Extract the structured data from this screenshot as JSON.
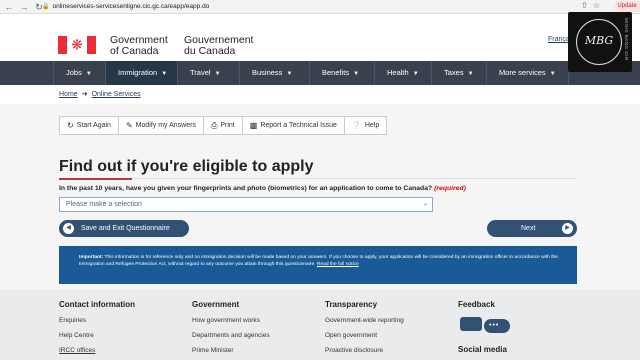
{
  "browser": {
    "url": "onlineservices-servicesenligne.cic.gc.ca/eapp/eapp.do",
    "update_label": "Update"
  },
  "header": {
    "signature_en_line1": "Government",
    "signature_en_line2": "of Canada",
    "signature_fr_line1": "Gouvernement",
    "signature_fr_line2": "du Canada",
    "language_link": "Français"
  },
  "watermark": {
    "mark": "MBG",
    "text": "MISHI BANG GIR"
  },
  "menu": {
    "items": [
      {
        "label": "Jobs"
      },
      {
        "label": "Immigration"
      },
      {
        "label": "Travel"
      },
      {
        "label": "Business"
      },
      {
        "label": "Benefits"
      },
      {
        "label": "Health"
      },
      {
        "label": "Taxes"
      },
      {
        "label": "More services"
      }
    ]
  },
  "breadcrumb": {
    "home": "Home",
    "current": "Online Services"
  },
  "toolbar": {
    "start_again": "Start Again",
    "modify_answers": "Modify my Answers",
    "print": "Print",
    "report_issue": "Report a Technical Issue",
    "help": "Help"
  },
  "page": {
    "title": "Find out if you're eligible to apply",
    "question": "In the past 10 years, have you given your fingerprints and photo (biometrics) for an application to come to Canada?",
    "required": "(required)",
    "select_value": "Please make a selection",
    "save_exit_label": "Save and Exit Questionnaire",
    "next_label": "Next"
  },
  "notice": {
    "label": "Important:",
    "text": "This information is for reference only and no immigration decision will be made based on your answers. If you choose to apply, your application will be considered by an immigration officer in accordance with the Immigration and Refugee Protection Act, without regard to any outcome you attain through this questionnaire.",
    "link": "Read the full notice"
  },
  "footer": {
    "contact": {
      "heading": "Contact information",
      "links": [
        "Enquiries",
        "Help Centre",
        "IRCC offices"
      ]
    },
    "government": {
      "heading": "Government",
      "links": [
        "How government works",
        "Departments and agencies",
        "Prime Minister"
      ]
    },
    "transparency": {
      "heading": "Transparency",
      "links": [
        "Government-wide reporting",
        "Open government",
        "Proactive disclosure"
      ]
    },
    "feedback": {
      "heading": "Feedback",
      "social_heading": "Social media"
    }
  }
}
